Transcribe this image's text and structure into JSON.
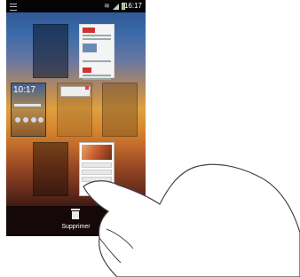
{
  "status_bar": {
    "time": "16:17",
    "menu_icon": "menu-icon",
    "wifi_icon": "wifi-icon",
    "signal_icon": "signal-icon",
    "battery_icon": "battery-icon"
  },
  "home_screen_preview": {
    "clock": "10:17"
  },
  "trash": {
    "label": "Supprimer",
    "icon": "trash-icon"
  },
  "colors": {
    "status_bar_bg": "#050505",
    "trash_bar_bg": "#140808",
    "battery_fill": "#8ed14a"
  }
}
